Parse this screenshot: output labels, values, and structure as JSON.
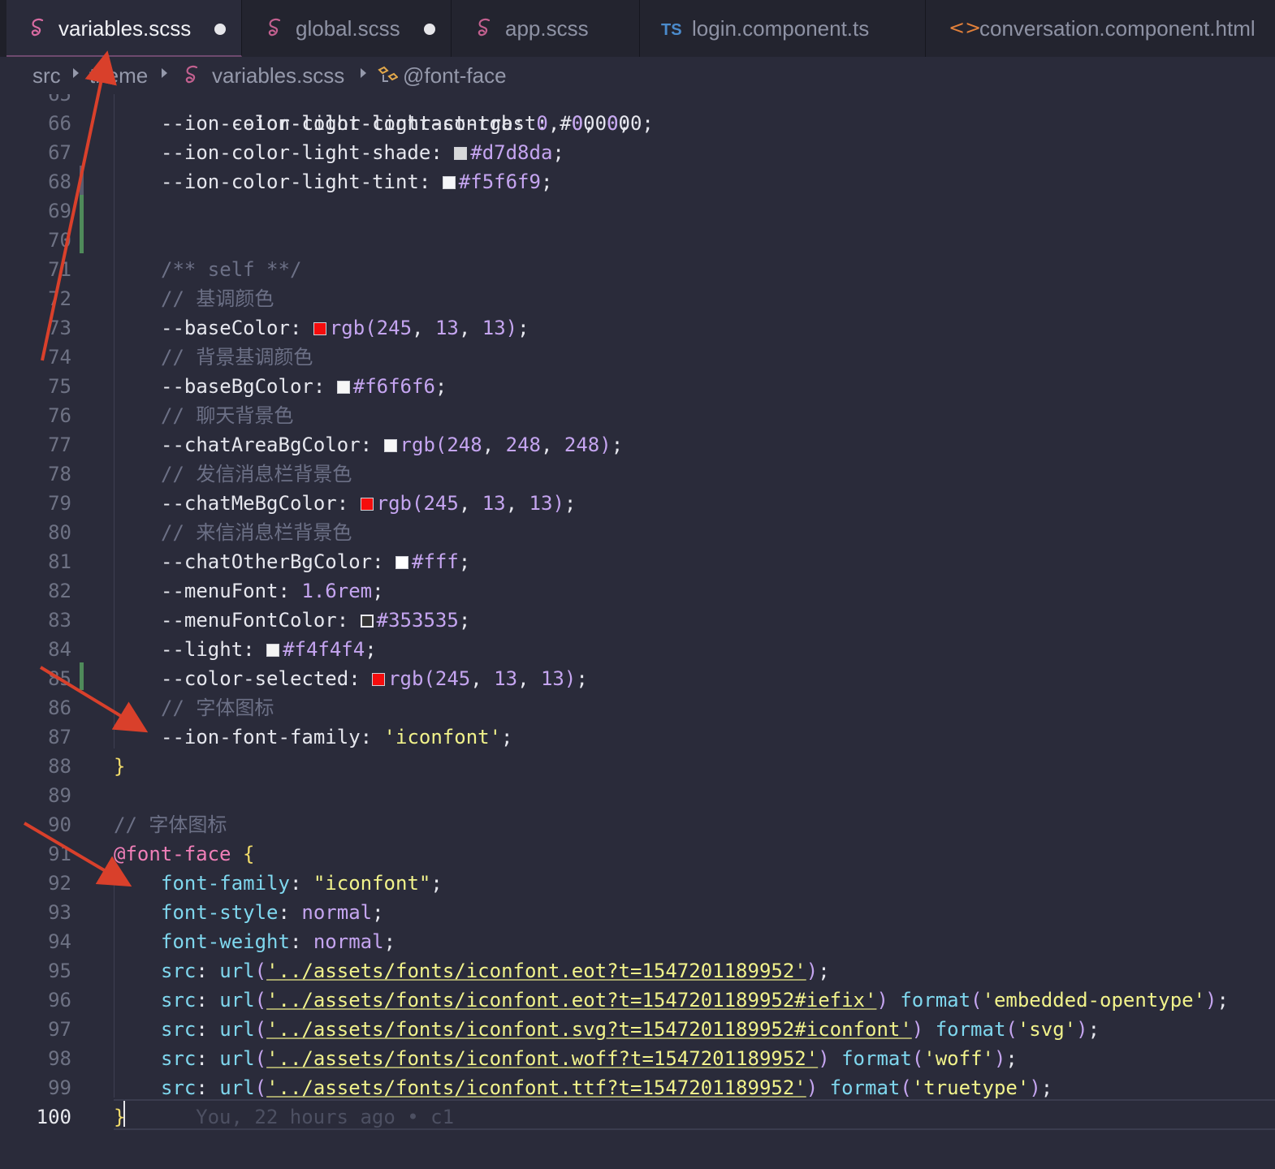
{
  "tabs": [
    {
      "label": "variables.scss",
      "icon": "sass-icon",
      "modified": true,
      "active": true
    },
    {
      "label": "global.scss",
      "icon": "sass-icon",
      "modified": true,
      "active": false
    },
    {
      "label": "app.scss",
      "icon": "sass-icon",
      "modified": false,
      "active": false
    },
    {
      "label": "login.component.ts",
      "icon": "ts-icon",
      "icon_text": "TS",
      "modified": false,
      "active": false
    },
    {
      "label": "conversation.component.html",
      "icon": "html-icon",
      "icon_text": "<>",
      "modified": false,
      "active": false
    }
  ],
  "breadcrumb": {
    "items": [
      "src",
      "theme",
      "variables.scss",
      "@font-face"
    ]
  },
  "editor": {
    "first_line_partial": "--ion-color-light-contrast: #000000;",
    "lines": [
      {
        "n": "66",
        "parts": [
          {
            "t": "--ion-color-light-contrast-rgb",
            "k": "var"
          },
          {
            "t": ": ",
            "k": "punct"
          },
          {
            "t": "0",
            "k": "num"
          },
          {
            "t": ", ",
            "k": "punct"
          },
          {
            "t": "0",
            "k": "num"
          },
          {
            "t": ", ",
            "k": "punct"
          },
          {
            "t": "0",
            "k": "num"
          },
          {
            "t": ";",
            "k": "punct"
          }
        ]
      },
      {
        "n": "67",
        "parts": [
          {
            "t": "--ion-color-light-shade",
            "k": "var"
          },
          {
            "t": ": ",
            "k": "punct"
          },
          {
            "sw": "#d7d8da"
          },
          {
            "t": "#d7d8da",
            "k": "hex"
          },
          {
            "t": ";",
            "k": "punct"
          }
        ]
      },
      {
        "n": "68",
        "parts": [
          {
            "t": "--ion-color-light-tint",
            "k": "var"
          },
          {
            "t": ": ",
            "k": "punct"
          },
          {
            "sw": "#f5f6f9"
          },
          {
            "t": "#f5f6f9",
            "k": "hex"
          },
          {
            "t": ";",
            "k": "punct"
          }
        ]
      },
      {
        "n": "69",
        "parts": []
      },
      {
        "n": "70",
        "parts": []
      },
      {
        "n": "71",
        "parts": [
          {
            "t": "/** self **/",
            "k": "comment"
          }
        ]
      },
      {
        "n": "72",
        "parts": [
          {
            "t": "// 基调颜色",
            "k": "comment"
          }
        ]
      },
      {
        "n": "73",
        "parts": [
          {
            "t": "--baseColor",
            "k": "var"
          },
          {
            "t": ": ",
            "k": "punct"
          },
          {
            "sw": "#f50d0d"
          },
          {
            "t": "rgb",
            "k": "func"
          },
          {
            "t": "(",
            "k": "func"
          },
          {
            "t": "245",
            "k": "num"
          },
          {
            "t": ", ",
            "k": "punct"
          },
          {
            "t": "13",
            "k": "num"
          },
          {
            "t": ", ",
            "k": "punct"
          },
          {
            "t": "13",
            "k": "num"
          },
          {
            "t": ")",
            "k": "func"
          },
          {
            "t": ";",
            "k": "punct"
          }
        ]
      },
      {
        "n": "74",
        "parts": [
          {
            "t": "// 背景基调颜色",
            "k": "comment"
          }
        ]
      },
      {
        "n": "75",
        "parts": [
          {
            "t": "--baseBgColor",
            "k": "var"
          },
          {
            "t": ": ",
            "k": "punct"
          },
          {
            "sw": "#f6f6f6"
          },
          {
            "t": "#f6f6f6",
            "k": "hex"
          },
          {
            "t": ";",
            "k": "punct"
          }
        ]
      },
      {
        "n": "76",
        "parts": [
          {
            "t": "// 聊天背景色",
            "k": "comment"
          }
        ]
      },
      {
        "n": "77",
        "parts": [
          {
            "t": "--chatAreaBgColor",
            "k": "var"
          },
          {
            "t": ": ",
            "k": "punct"
          },
          {
            "sw": "#f8f8f8"
          },
          {
            "t": "rgb",
            "k": "func"
          },
          {
            "t": "(",
            "k": "func"
          },
          {
            "t": "248",
            "k": "num"
          },
          {
            "t": ", ",
            "k": "punct"
          },
          {
            "t": "248",
            "k": "num"
          },
          {
            "t": ", ",
            "k": "punct"
          },
          {
            "t": "248",
            "k": "num"
          },
          {
            "t": ")",
            "k": "func"
          },
          {
            "t": ";",
            "k": "punct"
          }
        ]
      },
      {
        "n": "78",
        "parts": [
          {
            "t": "// 发信消息栏背景色",
            "k": "comment"
          }
        ]
      },
      {
        "n": "79",
        "parts": [
          {
            "t": "--chatMeBgColor",
            "k": "var"
          },
          {
            "t": ": ",
            "k": "punct"
          },
          {
            "sw": "#f50d0d"
          },
          {
            "t": "rgb",
            "k": "func"
          },
          {
            "t": "(",
            "k": "func"
          },
          {
            "t": "245",
            "k": "num"
          },
          {
            "t": ", ",
            "k": "punct"
          },
          {
            "t": "13",
            "k": "num"
          },
          {
            "t": ", ",
            "k": "punct"
          },
          {
            "t": "13",
            "k": "num"
          },
          {
            "t": ")",
            "k": "func"
          },
          {
            "t": ";",
            "k": "punct"
          }
        ]
      },
      {
        "n": "80",
        "parts": [
          {
            "t": "// 来信消息栏背景色",
            "k": "comment"
          }
        ]
      },
      {
        "n": "81",
        "parts": [
          {
            "t": "--chatOtherBgColor",
            "k": "var"
          },
          {
            "t": ": ",
            "k": "punct"
          },
          {
            "sw": "#ffffff"
          },
          {
            "t": "#fff",
            "k": "hex"
          },
          {
            "t": ";",
            "k": "punct"
          }
        ]
      },
      {
        "n": "82",
        "parts": [
          {
            "t": "--menuFont",
            "k": "var"
          },
          {
            "t": ": ",
            "k": "punct"
          },
          {
            "t": "1.6rem",
            "k": "num"
          },
          {
            "t": ";",
            "k": "punct"
          }
        ]
      },
      {
        "n": "83",
        "parts": [
          {
            "t": "--menuFontColor",
            "k": "var"
          },
          {
            "t": ": ",
            "k": "punct"
          },
          {
            "sw": "#353535"
          },
          {
            "t": "#353535",
            "k": "hex"
          },
          {
            "t": ";",
            "k": "punct"
          }
        ]
      },
      {
        "n": "84",
        "parts": [
          {
            "t": "--light",
            "k": "var"
          },
          {
            "t": ": ",
            "k": "punct"
          },
          {
            "sw": "#f4f4f4"
          },
          {
            "t": "#f4f4f4",
            "k": "hex"
          },
          {
            "t": ";",
            "k": "punct"
          }
        ]
      },
      {
        "n": "85",
        "parts": [
          {
            "t": "--color-selected",
            "k": "var"
          },
          {
            "t": ": ",
            "k": "punct"
          },
          {
            "sw": "#f50d0d"
          },
          {
            "t": "rgb",
            "k": "func"
          },
          {
            "t": "(",
            "k": "func"
          },
          {
            "t": "245",
            "k": "num"
          },
          {
            "t": ", ",
            "k": "punct"
          },
          {
            "t": "13",
            "k": "num"
          },
          {
            "t": ", ",
            "k": "punct"
          },
          {
            "t": "13",
            "k": "num"
          },
          {
            "t": ")",
            "k": "func"
          },
          {
            "t": ";",
            "k": "punct"
          }
        ]
      },
      {
        "n": "86",
        "parts": [
          {
            "t": "// 字体图标",
            "k": "comment"
          }
        ]
      },
      {
        "n": "87",
        "parts": [
          {
            "t": "--ion-font-family",
            "k": "var"
          },
          {
            "t": ": ",
            "k": "punct"
          },
          {
            "t": "'iconfont'",
            "k": "str"
          },
          {
            "t": ";",
            "k": "punct"
          }
        ]
      },
      {
        "n": "88",
        "outdent": true,
        "parts": [
          {
            "t": "}",
            "k": "brace"
          }
        ]
      },
      {
        "n": "89",
        "parts": []
      },
      {
        "n": "90",
        "outdent": true,
        "parts": [
          {
            "t": "// 字体图标",
            "k": "comment"
          }
        ]
      },
      {
        "n": "91",
        "outdent": true,
        "parts": [
          {
            "t": "@font-face",
            "k": "at"
          },
          {
            "t": " ",
            "k": "punct"
          },
          {
            "t": "{",
            "k": "brace"
          }
        ]
      },
      {
        "n": "92",
        "parts": [
          {
            "t": "font-family",
            "k": "prop"
          },
          {
            "t": ": ",
            "k": "punct"
          },
          {
            "t": "\"iconfont\"",
            "k": "str"
          },
          {
            "t": ";",
            "k": "punct"
          }
        ]
      },
      {
        "n": "93",
        "parts": [
          {
            "t": "font-style",
            "k": "prop"
          },
          {
            "t": ": ",
            "k": "punct"
          },
          {
            "t": "normal",
            "k": "kw"
          },
          {
            "t": ";",
            "k": "punct"
          }
        ]
      },
      {
        "n": "94",
        "parts": [
          {
            "t": "font-weight",
            "k": "prop"
          },
          {
            "t": ": ",
            "k": "punct"
          },
          {
            "t": "normal",
            "k": "kw"
          },
          {
            "t": ";",
            "k": "punct"
          }
        ]
      },
      {
        "n": "95",
        "parts": [
          {
            "t": "src",
            "k": "prop"
          },
          {
            "t": ": ",
            "k": "punct"
          },
          {
            "t": "url",
            "k": "prop"
          },
          {
            "t": "(",
            "k": "func"
          },
          {
            "t": "'../assets/fonts/iconfont.eot?t=1547201189952'",
            "k": "strul"
          },
          {
            "t": ")",
            "k": "func"
          },
          {
            "t": ";",
            "k": "punct"
          }
        ]
      },
      {
        "n": "96",
        "parts": [
          {
            "t": "src",
            "k": "prop"
          },
          {
            "t": ": ",
            "k": "punct"
          },
          {
            "t": "url",
            "k": "prop"
          },
          {
            "t": "(",
            "k": "func"
          },
          {
            "t": "'../assets/fonts/iconfont.eot?t=1547201189952#iefix'",
            "k": "strul"
          },
          {
            "t": ")",
            "k": "func"
          },
          {
            "t": " ",
            "k": "punct"
          },
          {
            "t": "format",
            "k": "prop"
          },
          {
            "t": "(",
            "k": "func"
          },
          {
            "t": "'embedded-opentype'",
            "k": "str"
          },
          {
            "t": ")",
            "k": "func"
          },
          {
            "t": ";",
            "k": "punct"
          }
        ]
      },
      {
        "n": "97",
        "parts": [
          {
            "t": "src",
            "k": "prop"
          },
          {
            "t": ": ",
            "k": "punct"
          },
          {
            "t": "url",
            "k": "prop"
          },
          {
            "t": "(",
            "k": "func"
          },
          {
            "t": "'../assets/fonts/iconfont.svg?t=1547201189952#iconfont'",
            "k": "strul"
          },
          {
            "t": ")",
            "k": "func"
          },
          {
            "t": " ",
            "k": "punct"
          },
          {
            "t": "format",
            "k": "prop"
          },
          {
            "t": "(",
            "k": "func"
          },
          {
            "t": "'svg'",
            "k": "str"
          },
          {
            "t": ")",
            "k": "func"
          },
          {
            "t": ";",
            "k": "punct"
          }
        ]
      },
      {
        "n": "98",
        "parts": [
          {
            "t": "src",
            "k": "prop"
          },
          {
            "t": ": ",
            "k": "punct"
          },
          {
            "t": "url",
            "k": "prop"
          },
          {
            "t": "(",
            "k": "func"
          },
          {
            "t": "'../assets/fonts/iconfont.woff?t=1547201189952'",
            "k": "strul"
          },
          {
            "t": ")",
            "k": "func"
          },
          {
            "t": " ",
            "k": "punct"
          },
          {
            "t": "format",
            "k": "prop"
          },
          {
            "t": "(",
            "k": "func"
          },
          {
            "t": "'woff'",
            "k": "str"
          },
          {
            "t": ")",
            "k": "func"
          },
          {
            "t": ";",
            "k": "punct"
          }
        ]
      },
      {
        "n": "99",
        "parts": [
          {
            "t": "src",
            "k": "prop"
          },
          {
            "t": ": ",
            "k": "punct"
          },
          {
            "t": "url",
            "k": "prop"
          },
          {
            "t": "(",
            "k": "func"
          },
          {
            "t": "'../assets/fonts/iconfont.ttf?t=1547201189952'",
            "k": "strul"
          },
          {
            "t": ")",
            "k": "func"
          },
          {
            "t": " ",
            "k": "punct"
          },
          {
            "t": "format",
            "k": "prop"
          },
          {
            "t": "(",
            "k": "func"
          },
          {
            "t": "'truetype'",
            "k": "str"
          },
          {
            "t": ")",
            "k": "func"
          },
          {
            "t": ";",
            "k": "punct"
          }
        ]
      },
      {
        "n": "100",
        "outdent": true,
        "current": true,
        "parts": [
          {
            "t": "}",
            "k": "brace"
          },
          {
            "t": "      You, 22 hours ago • c1",
            "k": "ghost"
          }
        ]
      }
    ]
  },
  "colors": {
    "annotation_arrow": "#d9402b",
    "editor_bg": "#2a2b3a",
    "tabbar_bg": "#1f2029"
  }
}
